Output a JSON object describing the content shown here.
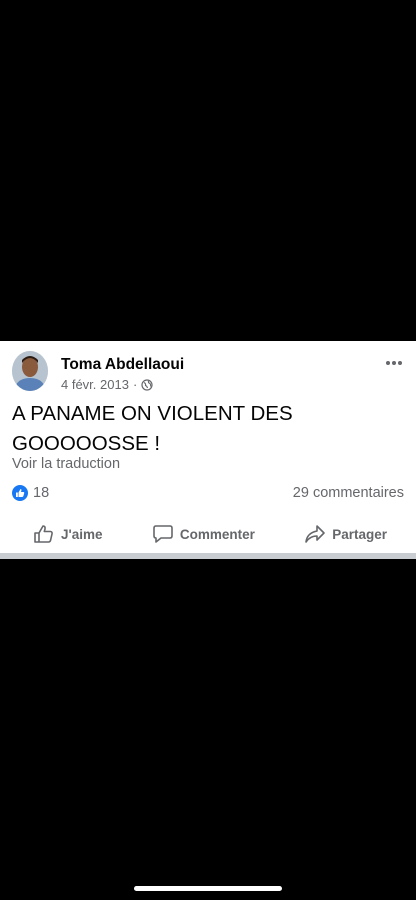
{
  "post": {
    "author": "Toma Abdellaoui",
    "date": "4 févr. 2013",
    "separator": "·",
    "audience_icon": "globe-icon",
    "text": "A PANAME ON VIOLENT DES GOOOOOSSE !",
    "translate_link": "Voir la traduction",
    "reactions_count": "18",
    "comments_count": "29 commentaires"
  },
  "actions": {
    "like_label": "J'aime",
    "comment_label": "Commenter",
    "share_label": "Partager"
  },
  "colors": {
    "brand_blue": "#1877f2",
    "secondary_text": "#65676b",
    "primary_text": "#050505",
    "background": "#000000"
  }
}
